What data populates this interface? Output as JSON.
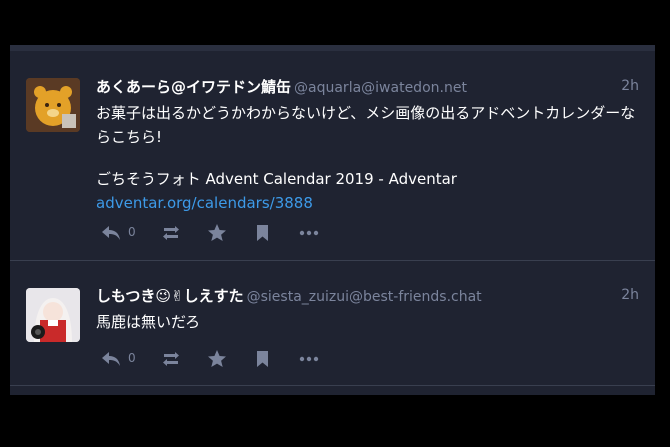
{
  "statuses": [
    {
      "display_name": "あくあーら@イワテドン鯖缶",
      "acct": "@aquarla@iwatedon.net",
      "time": "2h",
      "text_1": "お菓子は出るかどうかわからないけど、メシ画像の出るアドベントカレンダーならこちら!",
      "text_2": "ごちそうフォト Advent Calendar 2019 - Adventar",
      "link": "adventar.org/calendars/3888",
      "reply_count": "0"
    },
    {
      "display_name": "しもつき😉✌しえすた",
      "acct": "@siesta_zuizui@best-friends.chat",
      "time": "2h",
      "text_1": "馬鹿は無いだろ",
      "reply_count": "0"
    }
  ],
  "icons": [
    "reply-icon",
    "boost-icon",
    "favourite-icon",
    "bookmark-icon",
    "more-icon"
  ],
  "colors": {
    "background": "#1f2331",
    "text": "#ffffff",
    "muted": "#7b849c",
    "link": "#3d9ae8"
  }
}
